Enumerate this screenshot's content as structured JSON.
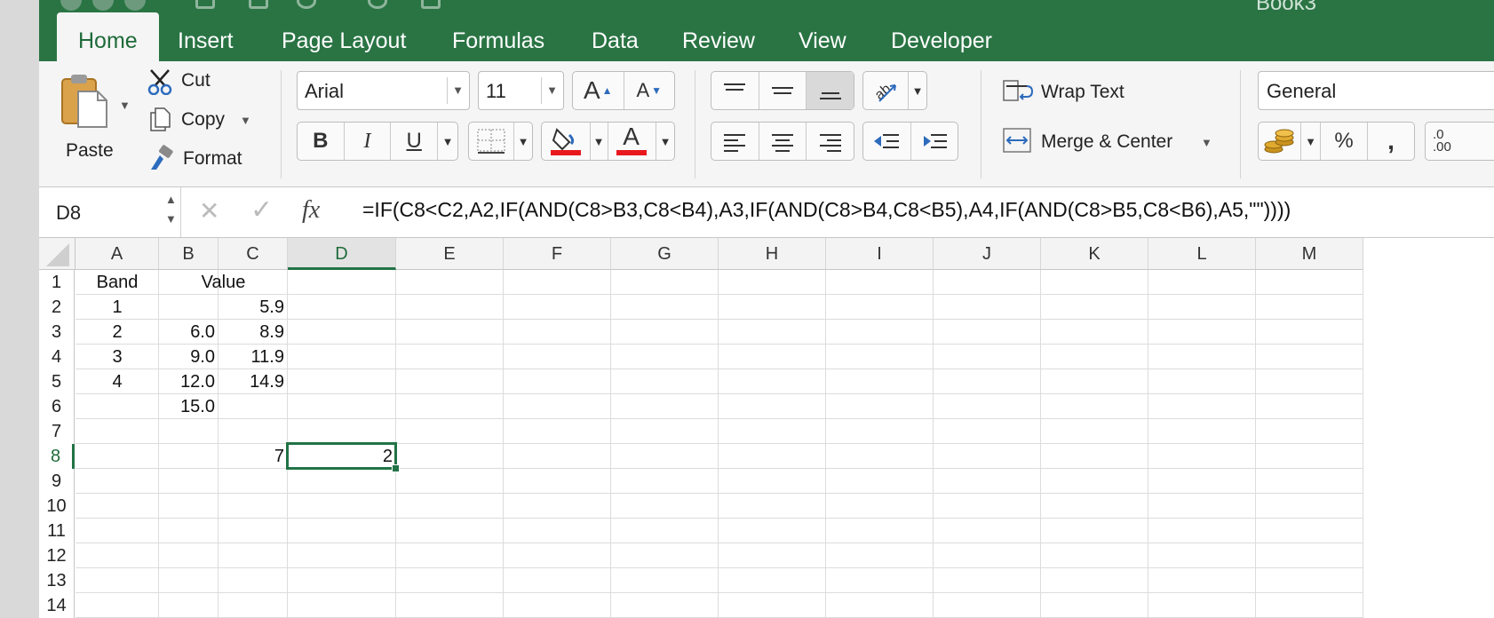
{
  "window": {
    "title": "Book3"
  },
  "tabs": [
    {
      "label": "Home",
      "active": true
    },
    {
      "label": "Insert"
    },
    {
      "label": "Page Layout"
    },
    {
      "label": "Formulas"
    },
    {
      "label": "Data"
    },
    {
      "label": "Review"
    },
    {
      "label": "View"
    },
    {
      "label": "Developer"
    }
  ],
  "ribbon": {
    "clipboard": {
      "paste": "Paste",
      "cut": "Cut",
      "copy": "Copy",
      "format": "Format"
    },
    "font": {
      "name": "Arial",
      "size": "11",
      "grow": "A",
      "shrink": "A",
      "bold": "B",
      "italic": "I",
      "underline": "U",
      "font_color_glyph": "A"
    },
    "alignment": {
      "wrap_text": "Wrap Text",
      "merge_center": "Merge & Center"
    },
    "number": {
      "format": "General",
      "percent": "%",
      "comma": ",",
      "decimal": ".0\n.00"
    }
  },
  "accent_colors": {
    "brand_green": "#217346",
    "fill_color": "#e8191e",
    "font_color": "#e8191e"
  },
  "formula_bar": {
    "name_box": "D8",
    "fx": "fx",
    "formula": "=IF(C8<C2,A2,IF(AND(C8>B3,C8<B4),A3,IF(AND(C8>B4,C8<B5),A4,IF(AND(C8>B5,C8<B6),A5,\"\"))))"
  },
  "grid": {
    "columns": [
      "A",
      "B",
      "C",
      "D",
      "E",
      "F",
      "G",
      "H",
      "I",
      "J",
      "K",
      "L",
      "M"
    ],
    "selected_cell": "D8",
    "rows": [
      "1",
      "2",
      "3",
      "4",
      "5",
      "6",
      "7",
      "8",
      "9",
      "10",
      "11",
      "12",
      "13",
      "14"
    ],
    "cells": {
      "A1": "Band",
      "B1": "Value",
      "A2": "1",
      "C2": "5.9",
      "A3": "2",
      "B3": "6.0",
      "C3": "8.9",
      "A4": "3",
      "B4": "9.0",
      "C4": "11.9",
      "A5": "4",
      "B5": "12.0",
      "C5": "14.9",
      "B6": "15.0",
      "C8": "7",
      "D8": "2"
    }
  }
}
